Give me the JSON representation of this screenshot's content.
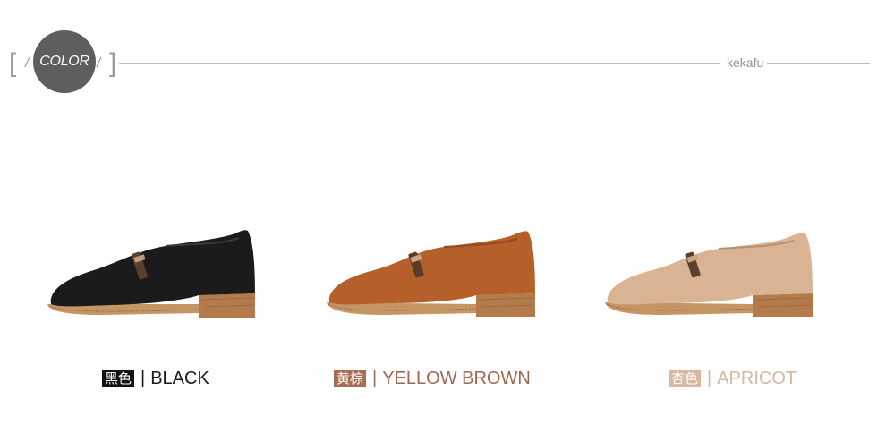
{
  "header": {
    "badge": "COLOR",
    "brand": "kekafu"
  },
  "colors_palette": {
    "black": "#111111",
    "brown": "#b5602a",
    "apricot": "#d9b393",
    "dark_circle": "#5e5e5e"
  },
  "variants": [
    {
      "cn": "黑色",
      "en": "BLACK",
      "label_color": "#1a1a1a",
      "chip_color": "#111111",
      "shoe_color": "#1b1b1b"
    },
    {
      "cn": "黄棕",
      "en": "YELLOW BROWN",
      "label_color": "#9c6a52",
      "chip_color": "#a56e53",
      "shoe_color": "#b5602a"
    },
    {
      "cn": "杏色",
      "en": "APRICOT",
      "label_color": "#d6b7a3",
      "chip_color": "#d9b7a0",
      "shoe_color": "#d9b393"
    }
  ]
}
